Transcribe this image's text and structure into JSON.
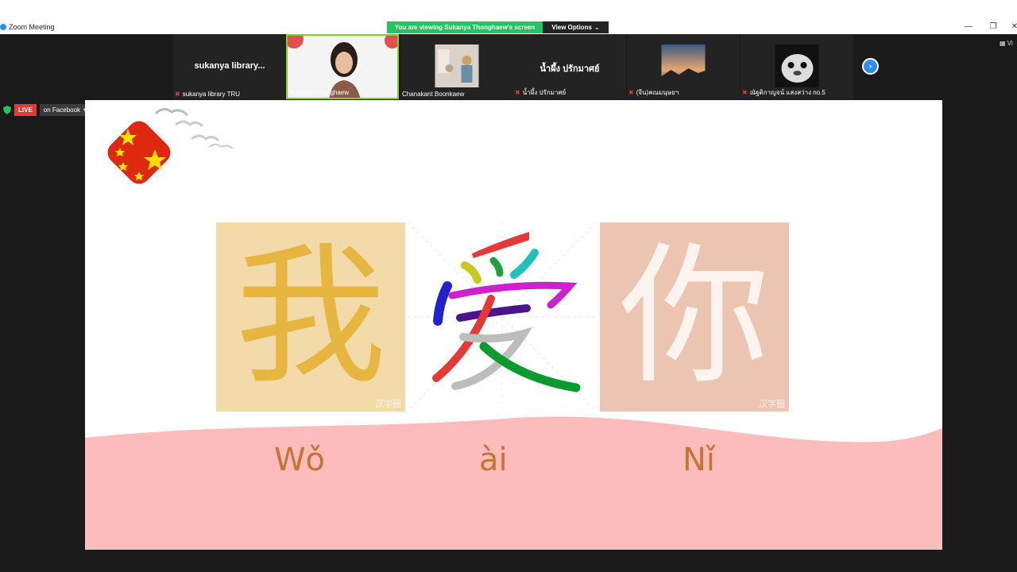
{
  "window": {
    "title": "Zoom Meeting"
  },
  "share": {
    "banner": "You are viewing Sukanya Thonghaew's screen",
    "view_options": "View Options"
  },
  "participants": [
    {
      "big_name": "sukanya  library...",
      "label": "sukanya library TRU",
      "muted": true
    },
    {
      "big_name": "",
      "label": "Sukanya Thonghaew",
      "muted": false,
      "active": true
    },
    {
      "big_name": "",
      "label": "Chanakant Boonkaew",
      "muted": false
    },
    {
      "big_name": "น้ำผึ้ง  ปรักมาศย์",
      "label": "น้ำผึ้ง  ปรักมาศย์",
      "muted": true
    },
    {
      "big_name": "",
      "label": "(จีน)คณมนุษยฯ",
      "muted": true
    },
    {
      "big_name": "",
      "label": "ณัฐติกาญจน์ แสงสว่าง no.5",
      "muted": true
    }
  ],
  "strip": {
    "next": "›",
    "view": "Vi"
  },
  "live": {
    "badge": "LIVE",
    "platform": "on Facebook"
  },
  "slide": {
    "characters": [
      "我",
      "爱",
      "你"
    ],
    "watermark": "汉字圈",
    "pinyin": [
      "Wǒ",
      "ài",
      "Nǐ"
    ]
  },
  "colors": {
    "share_banner": "#22c55e",
    "live": "#e53935",
    "accent": "#2d8cff",
    "wave": "#fcbcbc",
    "pinyin": "#c8732f"
  }
}
